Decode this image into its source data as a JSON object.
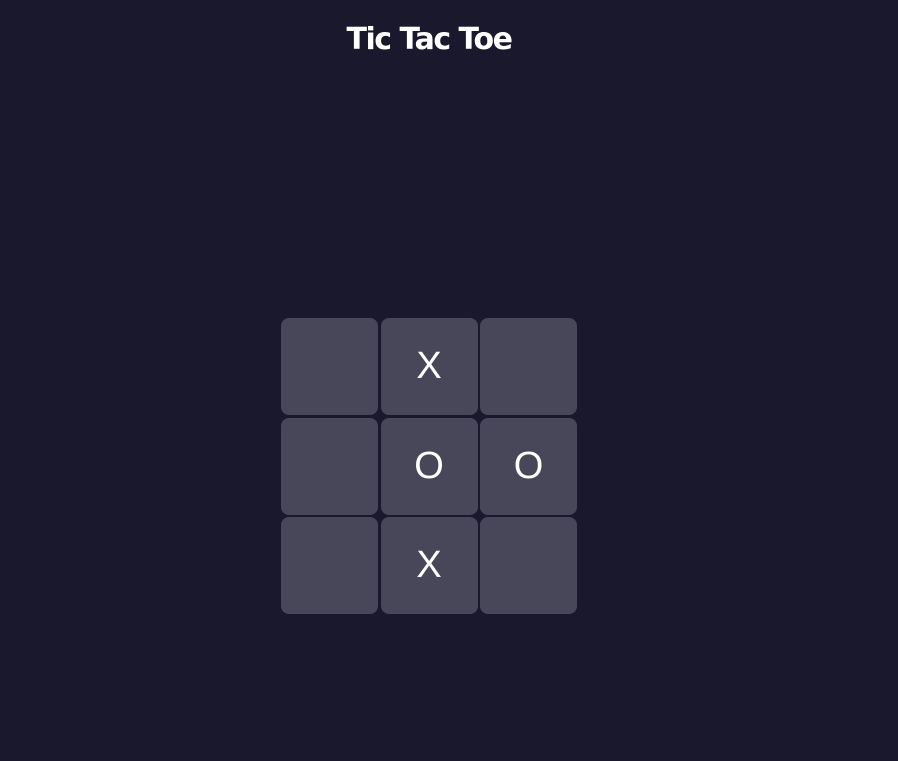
{
  "title": "Tic Tac Toe",
  "board": {
    "cells": [
      "",
      "X",
      "",
      "",
      "O",
      "O",
      "",
      "X",
      ""
    ]
  },
  "colors": {
    "background": "#1a182d",
    "cell": "#484659",
    "text": "#ffffff"
  }
}
